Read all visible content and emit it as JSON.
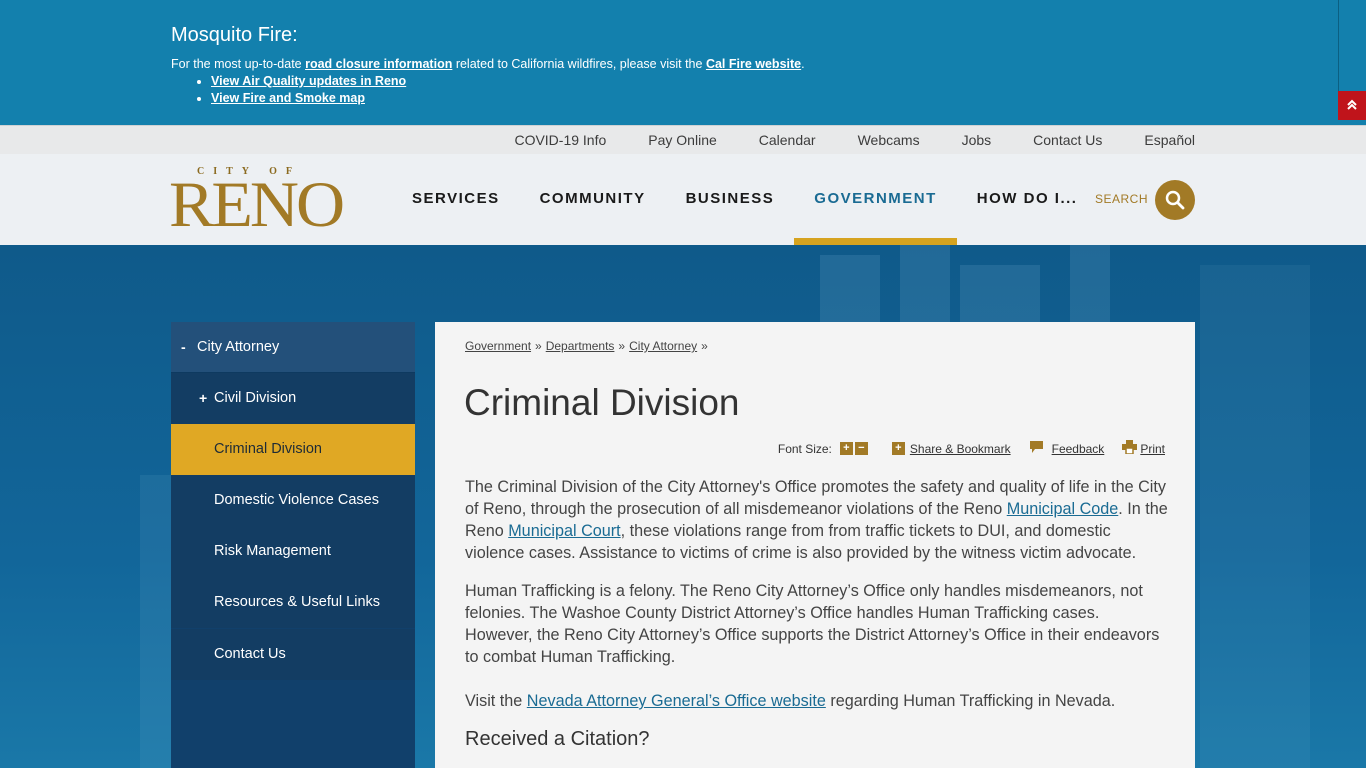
{
  "alert": {
    "title": "Mosquito Fire:",
    "text_before": "For the most up-to-date ",
    "link1": "road closure information",
    "text_mid": " related to California wildfires, please visit the ",
    "link2": "Cal Fire website",
    "text_end": ".",
    "bullets": [
      "View Air Quality updates in Reno",
      "View Fire and Smoke map"
    ],
    "toggle_icon": "double-chevron-up-icon"
  },
  "utility": {
    "links": [
      "COVID-19 Info",
      "Pay Online",
      "Calendar",
      "Webcams",
      "Jobs",
      "Contact Us",
      "Español"
    ]
  },
  "header": {
    "logo_top": "CITY OF",
    "logo_main": "RENO",
    "nav": [
      "SERVICES",
      "COMMUNITY",
      "BUSINESS",
      "GOVERNMENT",
      "HOW DO I..."
    ],
    "search_label": "SEARCH"
  },
  "sidebar": {
    "top": {
      "sign": "-",
      "label": "City Attorney"
    },
    "items": [
      {
        "sign": "+",
        "label": "Civil Division"
      },
      {
        "sign": "",
        "label": "Criminal Division"
      },
      {
        "sign": "",
        "label": "Domestic Violence Cases"
      },
      {
        "sign": "",
        "label": "Risk Management"
      },
      {
        "sign": "",
        "label": "Resources & Useful Links"
      },
      {
        "sign": "",
        "label": "Contact Us"
      }
    ]
  },
  "content": {
    "breadcrumbs": [
      "Government",
      "Departments",
      "City Attorney"
    ],
    "crumb_sep": "»",
    "title": "Criminal Division",
    "tools": {
      "font_size": "Font Size:",
      "plus": "+",
      "minus": "−",
      "share": "Share & Bookmark",
      "feedback": "Feedback",
      "print": "Print"
    },
    "p1_a": "The Criminal Division of the City Attorney's Office promotes the safety and quality of life in the City of Reno, through the prosecution of all misdemeanor violations of the Reno ",
    "p1_link1": "Municipal Code",
    "p1_b": ".  In the Reno ",
    "p1_link2": "Municipal Court",
    "p1_c": ", these violations range from from traffic tickets to DUI, and domestic violence cases. Assistance to victims of crime is also provided by the witness victim advocate.",
    "p2": "Human Trafficking is a felony.  The Reno City Attorney’s Office only handles misdemeanors, not felonies.  The Washoe County District Attorney’s Office handles Human Trafficking cases.  However, the Reno City Attorney’s Office supports the District Attorney’s Office in their endeavors to combat Human Trafficking.",
    "p3_a": "Visit the ",
    "p3_link": "Nevada Attorney General’s Office website",
    "p3_b": " regarding Human Trafficking in Nevada.",
    "h3": "Received a Citation?"
  }
}
